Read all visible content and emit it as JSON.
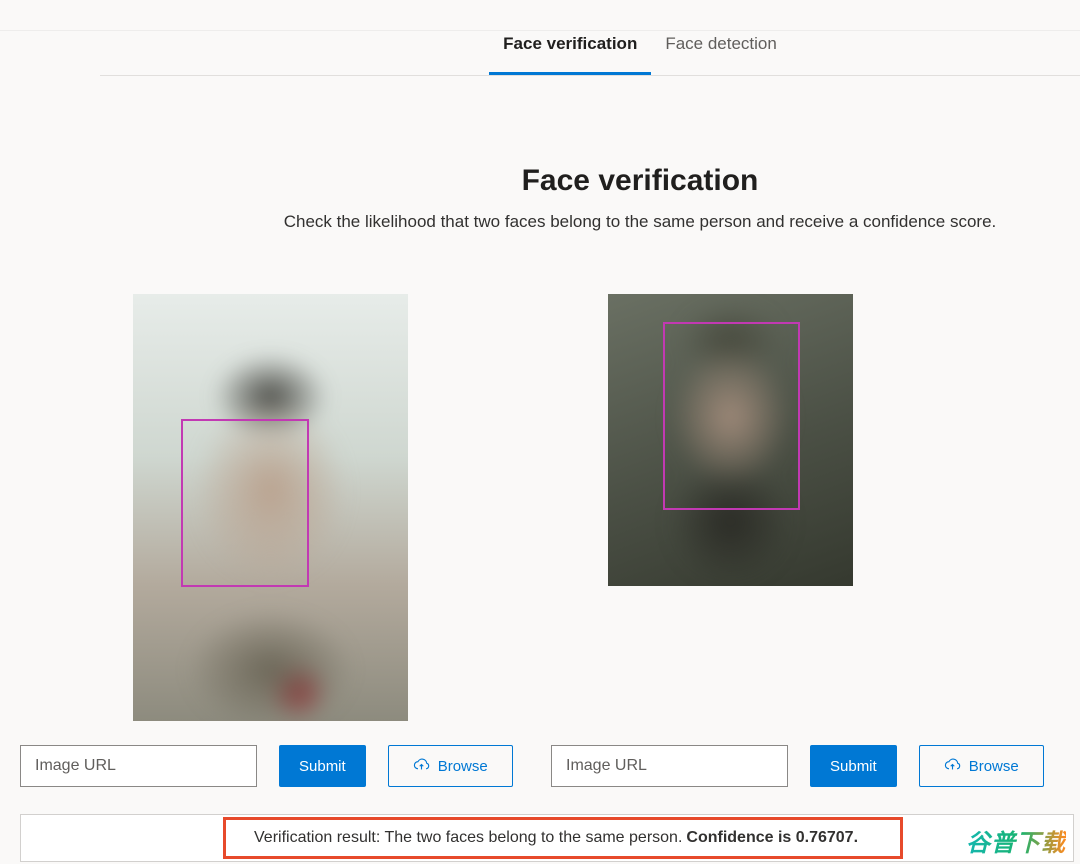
{
  "tabs": {
    "verification": "Face verification",
    "detection": "Face detection"
  },
  "heading": {
    "title": "Face verification",
    "subtitle": "Check the likelihood that two faces belong to the same person and receive a confidence score."
  },
  "colors": {
    "accent": "#0078d4",
    "face_box": "#c239b3",
    "highlight_box": "#e74a2b"
  },
  "input_left": {
    "placeholder": "Image URL",
    "value": "",
    "submit": "Submit",
    "browse": "Browse"
  },
  "input_right": {
    "placeholder": "Image URL",
    "value": "",
    "submit": "Submit",
    "browse": "Browse"
  },
  "result": {
    "prefix": "Verification result: The two faces belong to the same person.",
    "confidence_label": "Confidence is 0.76707.",
    "confidence_value": 0.76707
  },
  "watermark": "谷普下载"
}
